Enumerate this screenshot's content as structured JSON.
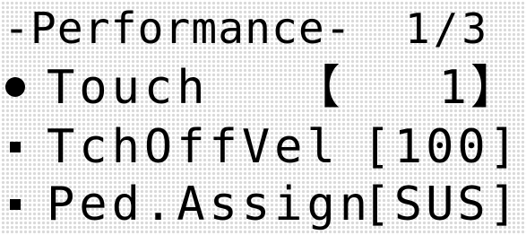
{
  "screen": {
    "title": "-Performance-",
    "page_indicator": "1/3"
  },
  "menu": {
    "items": [
      {
        "name": "Touch",
        "value": "【   1】",
        "selected": true
      },
      {
        "name": "TchOffVel",
        "value": "[100]",
        "selected": false
      },
      {
        "name": "Ped.Assign",
        "value": "[SUS]",
        "selected": false
      }
    ]
  }
}
